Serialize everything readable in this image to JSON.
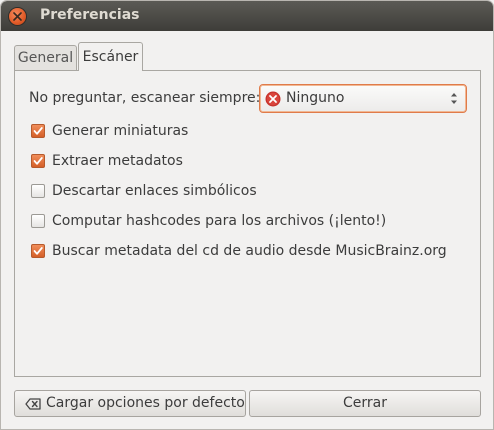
{
  "window": {
    "title": "Preferencias"
  },
  "tabs": [
    {
      "label": "General",
      "active": false
    },
    {
      "label": "Escáner",
      "active": true
    }
  ],
  "scanner": {
    "prompt_label": "No preguntar, escanear siempre:",
    "combo": {
      "value": "Ninguno",
      "icon": "error-circle-icon"
    },
    "options": [
      {
        "label": "Generar miniaturas",
        "checked": true
      },
      {
        "label": "Extraer metadatos",
        "checked": true
      },
      {
        "label": "Descartar enlaces simbólicos",
        "checked": false
      },
      {
        "label": "Computar hashcodes para los archivos (¡lento!)",
        "checked": false
      },
      {
        "label": "Buscar metadata del cd de audio desde MusicBrainz.org",
        "checked": true
      }
    ]
  },
  "buttons": {
    "defaults_label": "Cargar opciones por defecto",
    "defaults_icon": "clear-backspace-icon",
    "close_label": "Cerrar"
  },
  "colors": {
    "accent": "#e05a27",
    "titlebar": "#3e3d39",
    "background": "#f2f1f0"
  }
}
